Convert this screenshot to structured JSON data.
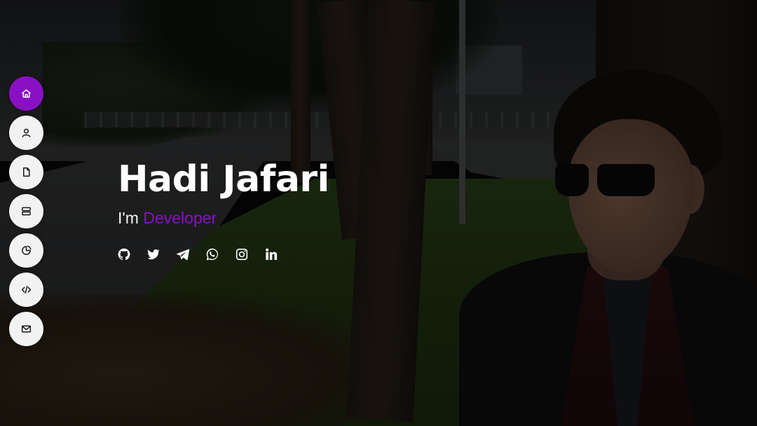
{
  "hero": {
    "name": "Hadi Jafari",
    "prefix": "I'm",
    "role": "Developer"
  },
  "theme": {
    "accent": "#8a10c4",
    "nav_button_bg": "#f2f2f2",
    "text": "#ffffff"
  },
  "nav": {
    "items": [
      {
        "icon": "home-icon",
        "active": true
      },
      {
        "icon": "user-icon",
        "active": false
      },
      {
        "icon": "file-icon",
        "active": false
      },
      {
        "icon": "server-icon",
        "active": false
      },
      {
        "icon": "chart-pie-icon",
        "active": false
      },
      {
        "icon": "code-icon",
        "active": false
      },
      {
        "icon": "envelope-icon",
        "active": false
      }
    ]
  },
  "social": {
    "items": [
      {
        "icon": "github-icon"
      },
      {
        "icon": "twitter-icon"
      },
      {
        "icon": "telegram-icon"
      },
      {
        "icon": "whatsapp-icon"
      },
      {
        "icon": "instagram-icon"
      },
      {
        "icon": "linkedin-icon"
      }
    ]
  }
}
